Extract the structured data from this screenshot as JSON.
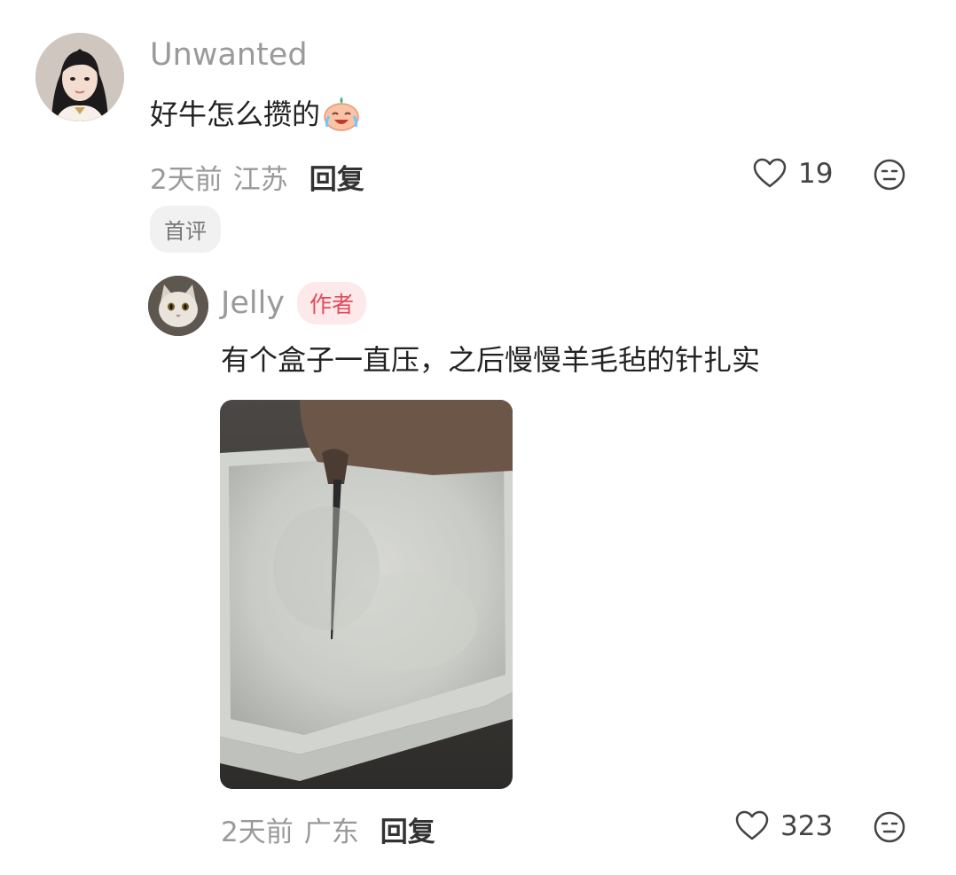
{
  "comments": [
    {
      "username": "Unwanted",
      "text": "好牛怎么攒的",
      "emoji": "crying-laughing-emoji",
      "time": "2天前",
      "location": "江苏",
      "reply_label": "回复",
      "likes": "19",
      "badge": "首评"
    },
    {
      "username": "Jelly",
      "author_badge": "作者",
      "text": "有个盒子一直压，之后慢慢羊毛毡的针扎实",
      "time": "2天前",
      "location": "广东",
      "reply_label": "回复",
      "likes": "323",
      "image": "wool-felt-needle-photo"
    }
  ],
  "icons": {
    "like": "heart-outline-icon",
    "dislike": "neutral-face-icon"
  },
  "colors": {
    "username": "#9a9a9a",
    "author_badge_bg": "#fde8ea",
    "author_badge_text": "#e24a5a",
    "first_badge_bg": "#f1f1f1"
  }
}
